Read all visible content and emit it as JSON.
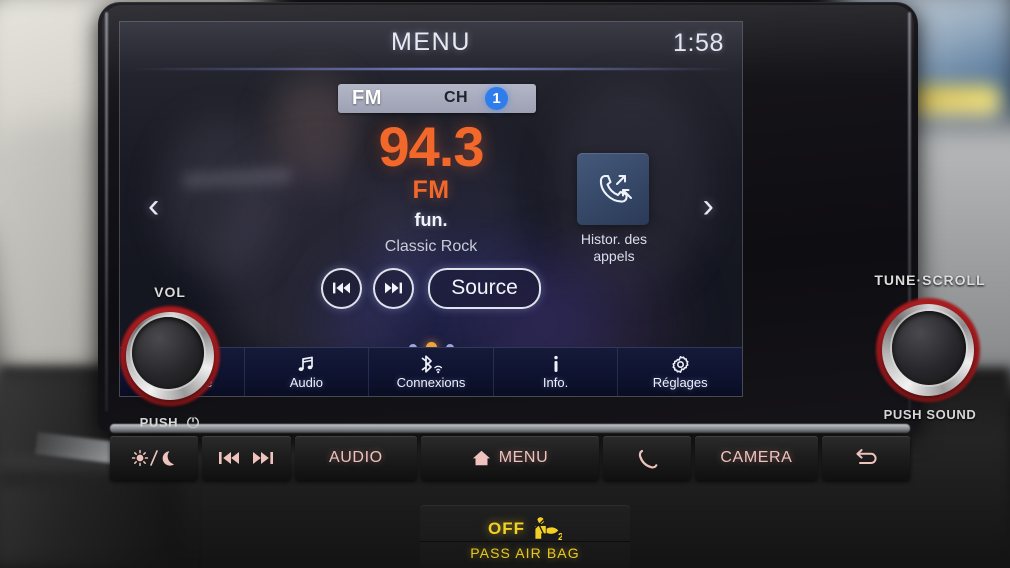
{
  "screen": {
    "title": "MENU",
    "clock": "1:58",
    "band": {
      "name": "FM",
      "ch_label": "CH",
      "ch_number": "1"
    },
    "now_playing": {
      "frequency": "94.3",
      "unit": "FM",
      "station": "fun.",
      "genre": "Classic Rock"
    },
    "transport": {
      "prev_icon": "previous-track-icon",
      "next_icon": "next-track-icon",
      "source_label": "Source"
    },
    "arrows": {
      "left": "‹",
      "right": "›"
    },
    "tile": {
      "icon": "call-history-icon",
      "label_line1": "Histor. des",
      "label_line2": "appels"
    },
    "pager": {
      "count": 3,
      "active_index": 1
    },
    "navbar": [
      {
        "label": "Téléphone",
        "icon": "phone-icon"
      },
      {
        "label": "Audio",
        "icon": "music-note-icon"
      },
      {
        "label": "Connexions",
        "icon": "bluetooth-wifi-icon"
      },
      {
        "label": "Info.",
        "icon": "info-icon"
      },
      {
        "label": "Réglages",
        "icon": "gear-icon"
      }
    ]
  },
  "knobs": {
    "left": {
      "top_label": "VOL",
      "bottom_label": "PUSH",
      "bottom_icon": "power-icon"
    },
    "right": {
      "top_label": "TUNE·SCROLL",
      "bottom_label": "PUSH SOUND"
    }
  },
  "hard_buttons": [
    {
      "label": "",
      "icon": "brightness-day-night-icon"
    },
    {
      "label": "",
      "icon": "prev-next-track-icon"
    },
    {
      "label": "AUDIO",
      "icon": ""
    },
    {
      "label": "MENU",
      "icon": "home-icon"
    },
    {
      "label": "",
      "icon": "phone-icon"
    },
    {
      "label": "CAMERA",
      "icon": ""
    },
    {
      "label": "",
      "icon": "back-arrow-icon"
    }
  ],
  "airbag": {
    "status": "OFF",
    "icon": "passenger-airbag-icon",
    "label": "PASS AIR BAG"
  },
  "colors": {
    "frequency_orange": "#f2672a",
    "active_dot_orange": "#f0a33a",
    "channel_blue": "#2f7ceb",
    "knob_ring_red": "#d4262a",
    "airbag_yellow": "#f2d024",
    "button_label_salmon": "#efc3bd"
  }
}
